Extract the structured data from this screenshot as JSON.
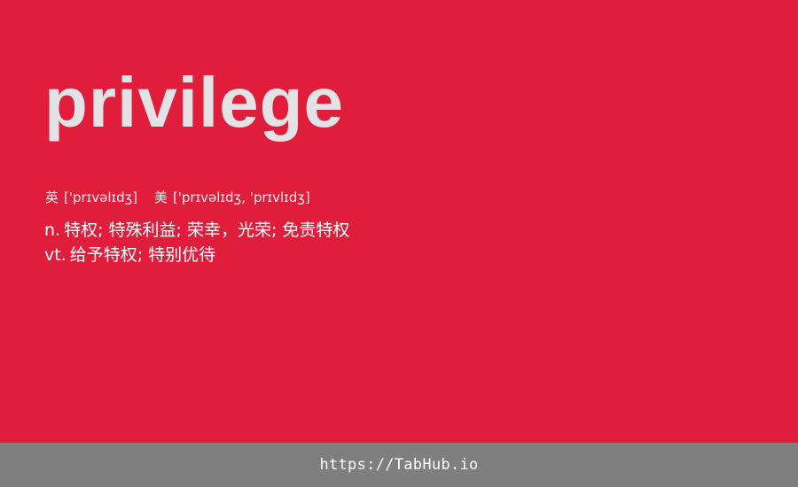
{
  "theme": {
    "background": "#e01e3c",
    "word_color": "#e3e3e6",
    "footer_background": "#7f7f7f"
  },
  "entry": {
    "word": "privilege",
    "phonetics": {
      "uk": {
        "label": "英",
        "ipa": "['prɪvəlɪdʒ]"
      },
      "us": {
        "label": "美",
        "ipa": "['prɪvəlɪdʒ, 'prɪvlɪdʒ]"
      }
    },
    "definitions": [
      {
        "pos": "n.",
        "meaning": "特权; 特殊利益; 荣幸，光荣; 免责特权"
      },
      {
        "pos": "vt.",
        "meaning": "给予特权; 特别优待"
      }
    ]
  },
  "footer": {
    "link_text": "https://TabHub.io"
  }
}
